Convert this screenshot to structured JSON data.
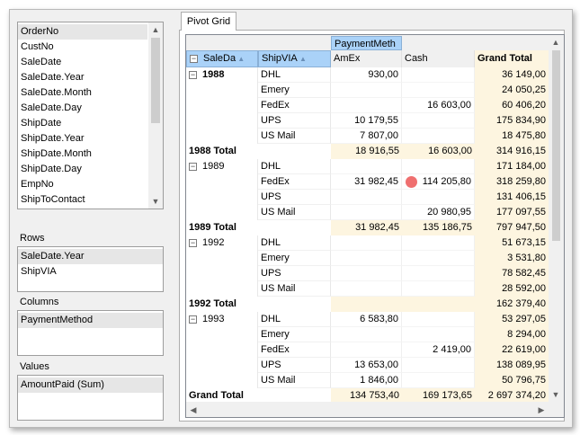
{
  "tab": {
    "label": "Pivot Grid"
  },
  "field_list": [
    "OrderNo",
    "CustNo",
    "SaleDate",
    "SaleDate.Year",
    "SaleDate.Month",
    "SaleDate.Day",
    "ShipDate",
    "ShipDate.Year",
    "ShipDate.Month",
    "ShipDate.Day",
    "EmpNo",
    "ShipToContact"
  ],
  "areas": {
    "rows": {
      "label": "Rows",
      "fields": [
        "SaleDate.Year",
        "ShipVIA"
      ]
    },
    "columns": {
      "label": "Columns",
      "fields": [
        "PaymentMethod"
      ]
    },
    "values": {
      "label": "Values",
      "fields": [
        "AmountPaid (Sum)"
      ]
    }
  },
  "pivot": {
    "header": {
      "column_field_button": "PaymentMeth",
      "row_field_buttons": [
        "SaleDa",
        "ShipVIA"
      ],
      "value_columns": [
        "AmEx",
        "Cash"
      ],
      "grand_total": "Grand Total"
    },
    "rows": [
      {
        "year": "1988",
        "ship": "DHL",
        "amex": "930,00",
        "cash": "",
        "total": "36 149,00",
        "year_bold": true
      },
      {
        "year": "",
        "ship": "Emery",
        "amex": "",
        "cash": "",
        "total": "24 050,25"
      },
      {
        "year": "",
        "ship": "FedEx",
        "amex": "",
        "cash": "16 603,00",
        "total": "60 406,20"
      },
      {
        "year": "",
        "ship": "UPS",
        "amex": "10 179,55",
        "cash": "",
        "total": "175 834,90"
      },
      {
        "year": "",
        "ship": "US Mail",
        "amex": "7 807,00",
        "cash": "",
        "total": "18 475,80"
      },
      {
        "subtotal": "1988 Total",
        "amex": "18 916,55",
        "cash": "16 603,00",
        "total": "314 916,15"
      },
      {
        "year": "1989",
        "ship": "DHL",
        "amex": "",
        "cash": "",
        "total": "171 184,00"
      },
      {
        "year": "",
        "ship": "FedEx",
        "amex": "31 982,45",
        "cash": "114 205,80",
        "total": "318 259,80",
        "marker": true
      },
      {
        "year": "",
        "ship": "UPS",
        "amex": "",
        "cash": "",
        "total": "131 406,15"
      },
      {
        "year": "",
        "ship": "US Mail",
        "amex": "",
        "cash": "20 980,95",
        "total": "177 097,55"
      },
      {
        "subtotal": "1989 Total",
        "amex": "31 982,45",
        "cash": "135 186,75",
        "total": "797 947,50"
      },
      {
        "year": "1992",
        "ship": "DHL",
        "amex": "",
        "cash": "",
        "total": "51 673,15"
      },
      {
        "year": "",
        "ship": "Emery",
        "amex": "",
        "cash": "",
        "total": "3 531,80"
      },
      {
        "year": "",
        "ship": "UPS",
        "amex": "",
        "cash": "",
        "total": "78 582,45"
      },
      {
        "year": "",
        "ship": "US Mail",
        "amex": "",
        "cash": "",
        "total": "28 592,00"
      },
      {
        "subtotal": "1992 Total",
        "amex": "",
        "cash": "",
        "total": "162 379,40"
      },
      {
        "year": "1993",
        "ship": "DHL",
        "amex": "6 583,80",
        "cash": "",
        "total": "53 297,05"
      },
      {
        "year": "",
        "ship": "Emery",
        "amex": "",
        "cash": "",
        "total": "8 294,00"
      },
      {
        "year": "",
        "ship": "FedEx",
        "amex": "",
        "cash": "2 419,00",
        "total": "22 619,00"
      },
      {
        "year": "",
        "ship": "UPS",
        "amex": "13 653,00",
        "cash": "",
        "total": "138 089,95"
      },
      {
        "year": "",
        "ship": "US Mail",
        "amex": "1 846,00",
        "cash": "",
        "total": "50 796,75"
      },
      {
        "subtotal": "Grand Total",
        "amex": "134 753,40",
        "cash": "169 173,65",
        "total": "2 697 374,20"
      }
    ]
  },
  "colors": {
    "highlight": "#aad2f8",
    "total_bg": "#fdf5e0",
    "marker": "#ef6f6f"
  }
}
